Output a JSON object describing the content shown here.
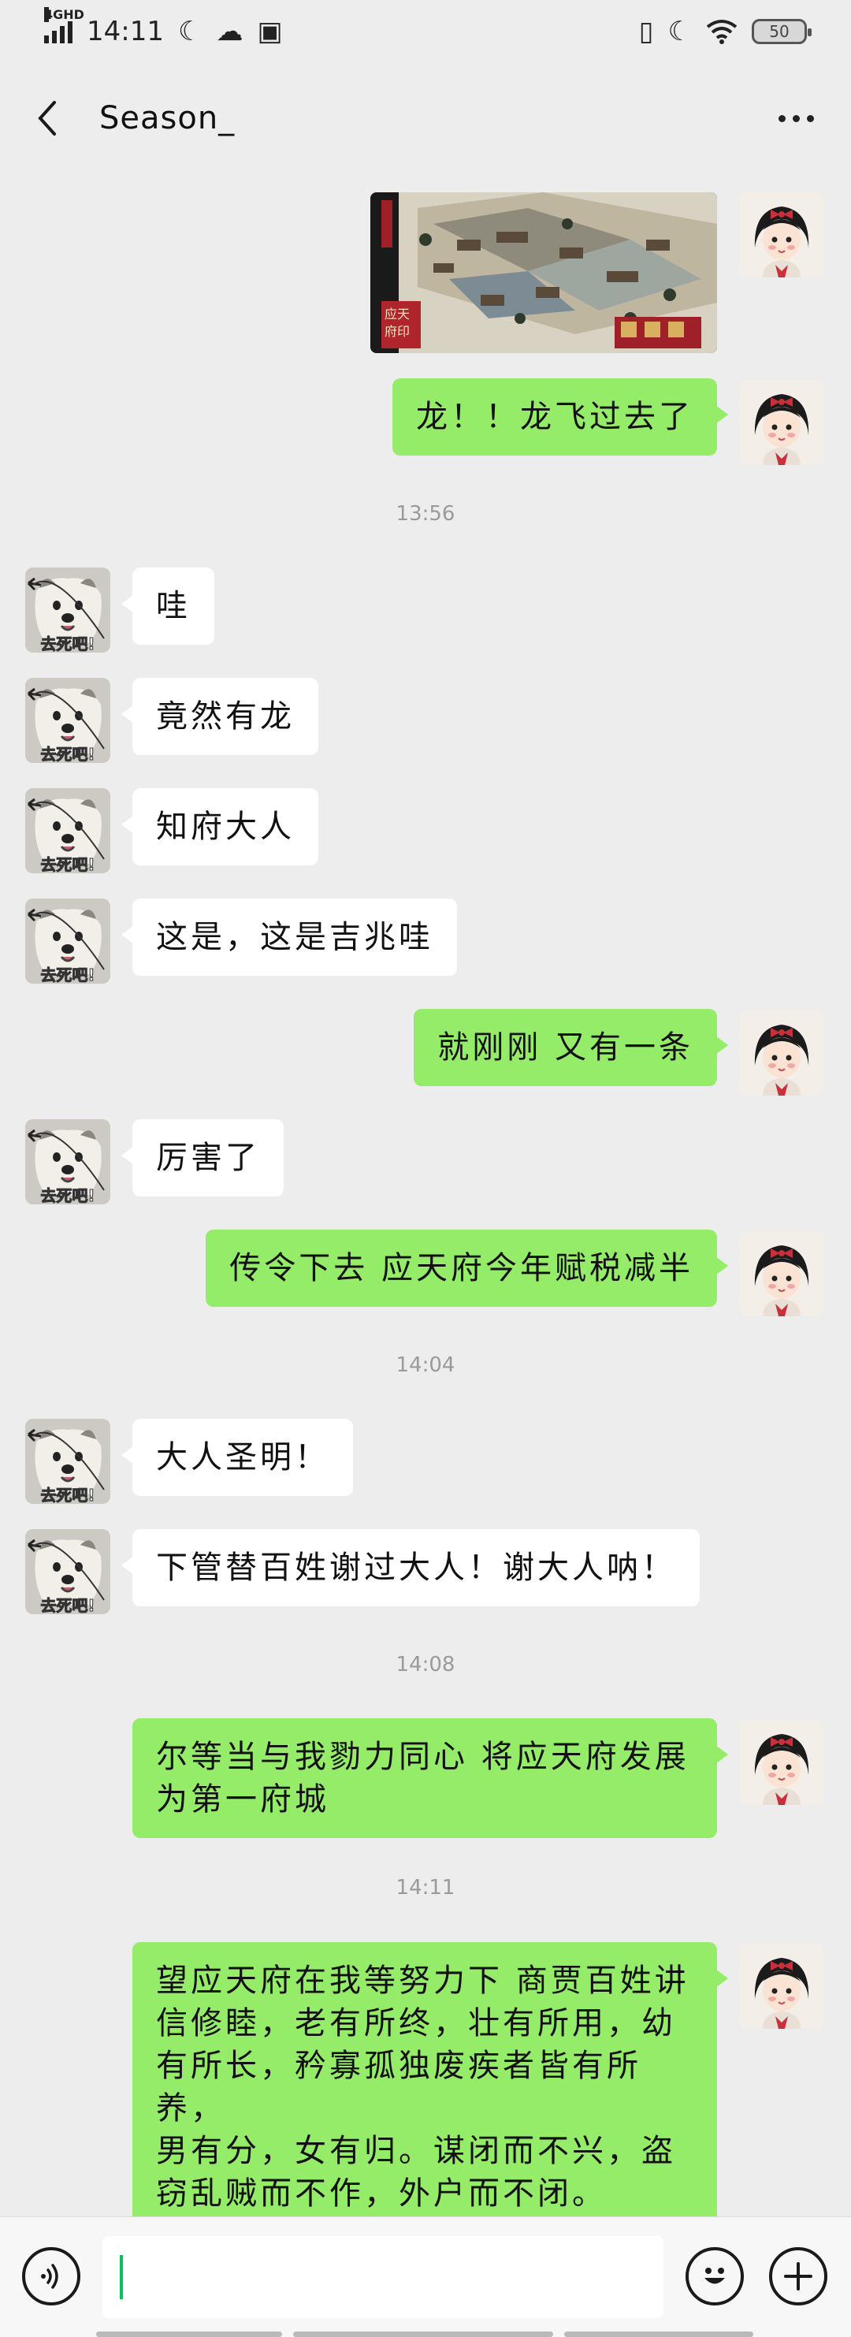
{
  "status_bar": {
    "network": "4GHD",
    "time": "14:11",
    "battery": "50"
  },
  "nav": {
    "title": "Season_"
  },
  "messages": [
    {
      "side": "me",
      "type": "image",
      "image_texts": [
        "应天",
        "府印"
      ]
    },
    {
      "side": "me",
      "type": "text",
      "text": "龙！！龙飞过去了"
    },
    {
      "type": "timestamp",
      "text": "13:56"
    },
    {
      "side": "other",
      "type": "text",
      "text": "哇"
    },
    {
      "side": "other",
      "type": "text",
      "text": "竟然有龙"
    },
    {
      "side": "other",
      "type": "text",
      "text": "知府大人"
    },
    {
      "side": "other",
      "type": "text",
      "text": "这是，这是吉兆哇"
    },
    {
      "side": "me",
      "type": "text",
      "text": "就刚刚 又有一条"
    },
    {
      "side": "other",
      "type": "text",
      "text": "厉害了"
    },
    {
      "side": "me",
      "type": "text",
      "text": "传令下去 应天府今年赋税减半"
    },
    {
      "type": "timestamp",
      "text": "14:04"
    },
    {
      "side": "other",
      "type": "text",
      "text": "大人圣明！"
    },
    {
      "side": "other",
      "type": "text",
      "text": "下管替百姓谢过大人！谢大人呐！"
    },
    {
      "type": "timestamp",
      "text": "14:08"
    },
    {
      "side": "me",
      "type": "text",
      "lines": [
        "尔等当与我勠力同心 将应天府发展",
        "为第一府城"
      ]
    },
    {
      "type": "timestamp",
      "text": "14:11"
    },
    {
      "side": "me",
      "type": "text",
      "lines": [
        "望应天府在我等努力下 商贾百姓讲",
        "信修睦，老有所终，壮有所用，幼",
        "有所长，矜寡孤独废疾者皆有所养，",
        "男有分，女有归。谋闭而不兴，盗",
        "窃乱贼而不作，外户而不闭。"
      ]
    }
  ],
  "avatar_other_caption": "去死吧!",
  "colors": {
    "my_bubble": "#95ec69",
    "their_bubble": "#ffffff",
    "background": "#ededed",
    "caret": "#07c160"
  },
  "icons": {
    "back": "chevron-left-icon",
    "more": "more-dots-icon",
    "voice": "voice-icon",
    "emoji": "emoji-icon",
    "add": "plus-icon"
  }
}
